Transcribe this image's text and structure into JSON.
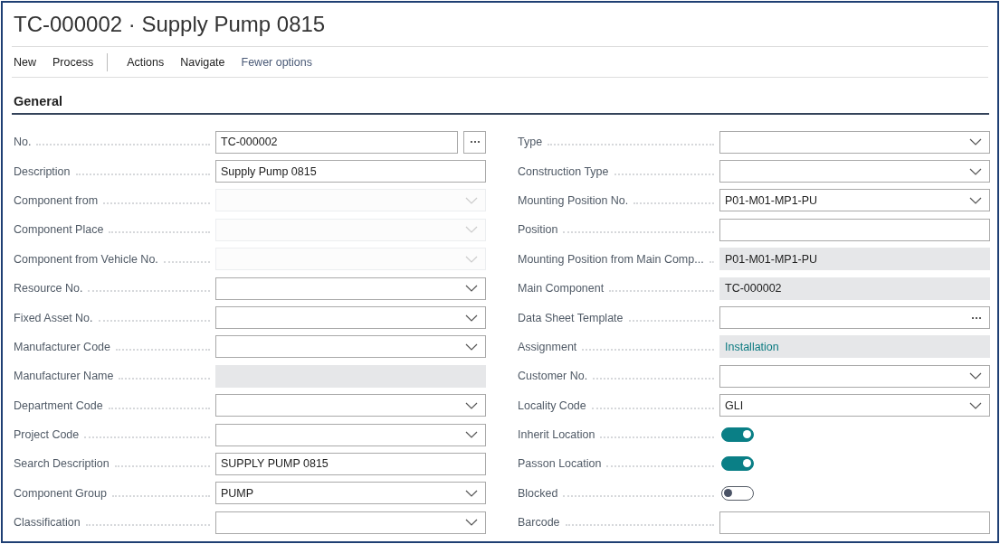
{
  "page": {
    "title": "TC-000002 · Supply Pump 0815"
  },
  "action_groups": [
    [
      "New",
      "Process"
    ],
    [
      "Actions",
      "Navigate"
    ]
  ],
  "options_link": "Fewer options",
  "section": {
    "title": "General",
    "left": [
      {
        "label": "No.",
        "kind": "lookup",
        "value": "TC-000002"
      },
      {
        "label": "Description",
        "kind": "text",
        "value": "Supply Pump 0815"
      },
      {
        "label": "Component from",
        "kind": "disabled-dropdown"
      },
      {
        "label": "Component Place",
        "kind": "disabled-dropdown"
      },
      {
        "label": "Component from Vehicle No.",
        "kind": "disabled-dropdown"
      },
      {
        "label": "Resource No.",
        "kind": "dropdown"
      },
      {
        "label": "Fixed Asset No.",
        "kind": "dropdown"
      },
      {
        "label": "Manufacturer Code",
        "kind": "dropdown"
      },
      {
        "label": "Manufacturer Name",
        "kind": "readonly"
      },
      {
        "label": "Department Code",
        "kind": "dropdown"
      },
      {
        "label": "Project Code",
        "kind": "dropdown"
      },
      {
        "label": "Search Description",
        "kind": "text",
        "value": "SUPPLY PUMP 0815"
      },
      {
        "label": "Component Group",
        "kind": "dropdown",
        "value": "PUMP"
      },
      {
        "label": "Classification",
        "kind": "dropdown"
      }
    ],
    "right": [
      {
        "label": "Type",
        "kind": "dropdown"
      },
      {
        "label": "Construction Type",
        "kind": "dropdown"
      },
      {
        "label": "Mounting Position No.",
        "kind": "dropdown",
        "value": "P01-M01-MP1-PU"
      },
      {
        "label": "Position",
        "kind": "text"
      },
      {
        "label": "Mounting Position from Main Comp...",
        "kind": "readonly",
        "value": "P01-M01-MP1-PU"
      },
      {
        "label": "Main Component",
        "kind": "readonly",
        "value": "TC-000002"
      },
      {
        "label": "Data Sheet Template",
        "kind": "assist"
      },
      {
        "label": "Assignment",
        "kind": "readonly-link",
        "value": "Installation"
      },
      {
        "label": "Customer No.",
        "kind": "dropdown"
      },
      {
        "label": "Locality Code",
        "kind": "dropdown",
        "value": "GLI"
      },
      {
        "label": "Inherit Location",
        "kind": "toggle",
        "on": true
      },
      {
        "label": "Passon Location",
        "kind": "toggle",
        "on": true
      },
      {
        "label": "Blocked",
        "kind": "toggle",
        "on": false
      },
      {
        "label": "Barcode",
        "kind": "text"
      }
    ]
  }
}
